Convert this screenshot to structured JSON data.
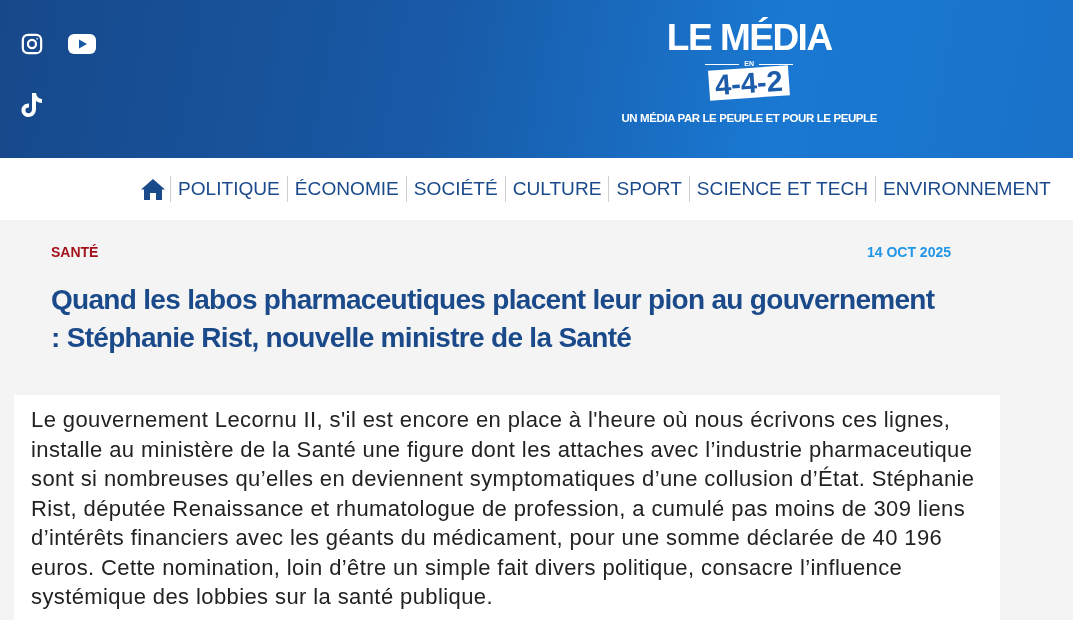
{
  "logo": {
    "title": "LE MÉDIA",
    "small": "EN",
    "badge": "4-4-2",
    "tagline": "UN MÉDIA PAR LE PEUPLE ET POUR LE PEUPLE"
  },
  "nav": {
    "items": [
      "POLITIQUE",
      "ÉCONOMIE",
      "SOCIÉTÉ",
      "CULTURE",
      "SPORT",
      "SCIENCE ET TECH",
      "ENVIRONNEMENT"
    ]
  },
  "article": {
    "category": "SANTÉ",
    "date": "14 OCT 2025",
    "title": "Quand les labos pharmaceutiques placent leur pion au gouvernement : Stéphanie Rist, nouvelle ministre de la Santé",
    "body": "Le gouvernement Lecornu II, s'il est encore en place à l'heure où nous écrivons ces lignes, installe au ministère de la Santé une figure dont les attaches avec l’industrie pharmaceutique sont si nombreuses qu’elles en deviennent symptomatiques d’une collusion d’État. Stéphanie Rist, députée Renaissance et rhumatologue de profession, a cumulé pas moins de 309 liens d’intérêts financiers avec les géants du médicament, pour une somme déclarée de 40 196 euros. Cette nomination, loin d’être un simple fait divers politique, consacre l’influence systémique des lobbies sur la santé publique."
  }
}
